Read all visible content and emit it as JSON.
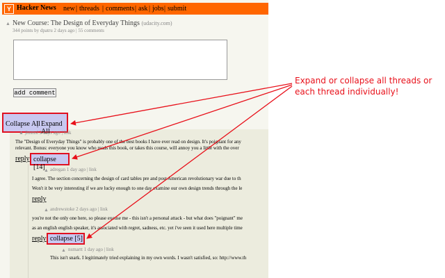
{
  "header": {
    "logo": "Y",
    "title": "Hacker News",
    "nav": [
      "new",
      "threads",
      "comments",
      "ask",
      "jobs",
      "submit"
    ]
  },
  "story": {
    "title": "New Course: The Design of Everyday Things",
    "domain": "(udacity.com)",
    "subtext": "344 points by dpatru 2 days ago | 55 comments"
  },
  "form": {
    "add_comment_label": "add comment"
  },
  "controls": {
    "collapse_all": "Collapse All",
    "separator": "|",
    "expand_all": "Expand All"
  },
  "comments": [
    {
      "meta": "jhnmsl 2 days ago | link",
      "lines": [
        "The \"Design of Everyday Things\" is probably one of the best books I have ever read on design. It's poignant for any",
        "relevant. Bonus: everyone you know who reads this book, or takes this course, will annoy you a little with the over"
      ],
      "reply": "reply",
      "collapse": "collapse [14]"
    },
    {
      "meta": "adregan 1 day ago | link",
      "lines": [
        "I agree. The section concerning the design of card tables pre and post American revolutionary war due to th",
        "Won't it be very interesting if we are lucky enough to one day examine our own design trends through the le"
      ],
      "reply": "reply"
    },
    {
      "meta": "andrewstoke 2 days ago | link",
      "lines": [
        "you're not the only one here, so please excuse me - this isn't a personal attack - but what does \"poignant\" me",
        "as an english english speaker, it's associated with regret, sadness, etc. yet i've seen it used here multiple time"
      ],
      "reply": "reply",
      "collapse": "collapse [5]"
    },
    {
      "meta": "nsmartt 1 day ago | link",
      "lines": [
        "This isn't snark. I legitimately tried explaining in my own words. I wasn't satisfied, so: http://www.th"
      ]
    }
  ],
  "annotation": {
    "text": "Expand or collapse all threads or each thread individually!",
    "color": "#e8101a"
  },
  "colors": {
    "hn_orange": "#ff6600",
    "page_bg": "#f6f6ef",
    "button_highlight": "#c8c8f0",
    "red_outline": "#e01020"
  }
}
